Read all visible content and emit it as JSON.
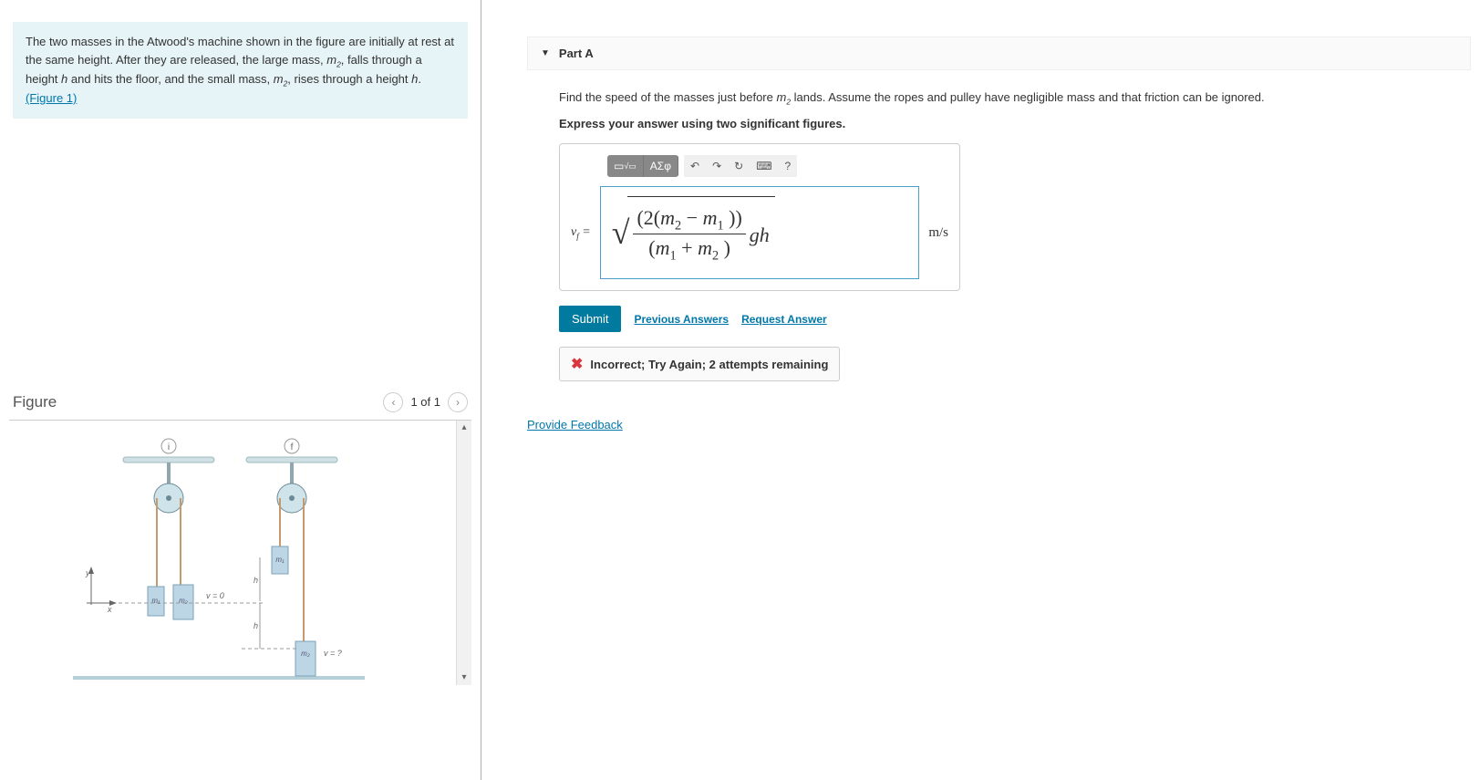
{
  "problem": {
    "text_pre": "The two masses in the Atwood's machine shown in the figure are initially at rest at the same height. After they are released, the large mass, ",
    "m2": "m",
    "m2_sub": "2",
    "text_mid1": ", falls through a height ",
    "h_it": "h",
    "text_mid2": " and hits the floor, and the small mass, ",
    "text_mid3": ", rises through a height ",
    "text_end": ".",
    "figure_link": "(Figure 1)"
  },
  "figure": {
    "title": "Figure",
    "pager": "1 of 1",
    "labels": {
      "y": "y",
      "x": "x",
      "m1": "m₁",
      "m2": "m₂",
      "v0": "v = 0",
      "h": "h",
      "vq": "v = ?",
      "i": "i",
      "f": "f"
    }
  },
  "partA": {
    "heading": "Part A",
    "question_pre": "Find the speed of the masses just before ",
    "question_post": " lands. Assume the ropes and pulley have negligible mass and that friction can be ignored.",
    "instruction": "Express your answer using two significant figures.",
    "toolbar": {
      "template": "▭",
      "frac": "▭/▭",
      "greek": "ΑΣφ",
      "undo": "↶",
      "redo": "↷",
      "reset": "↻",
      "keyboard": "⌨",
      "help": "?"
    },
    "vf_label": "v",
    "vf_sub": "f",
    "equals": " = ",
    "eq": {
      "num_pre": "(2(",
      "num_minus": " − ",
      "num_post": " ))",
      "den_pre": "(",
      "den_plus": " + ",
      "den_post": " )",
      "tail": "gh"
    },
    "unit": "m/s",
    "submit": "Submit",
    "prev_answers": "Previous Answers",
    "request_answer": "Request Answer",
    "feedback": "Incorrect; Try Again; 2 attempts remaining"
  },
  "provide_feedback": "Provide Feedback"
}
